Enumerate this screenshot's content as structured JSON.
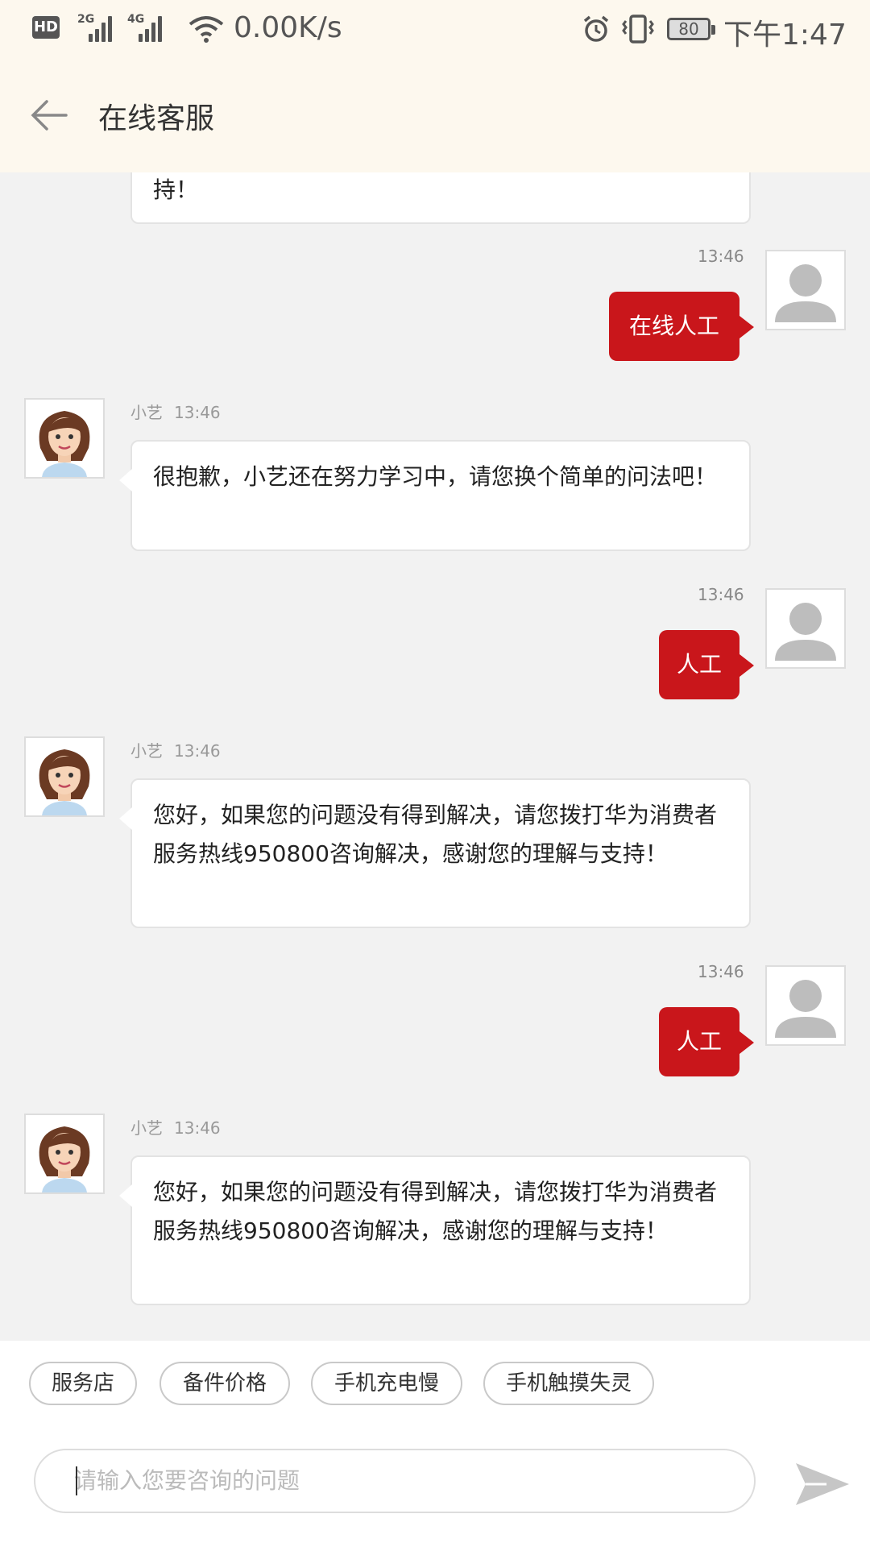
{
  "status_bar": {
    "hd": "HD",
    "sim1": "2G",
    "sim2": "4G",
    "net_speed": "0.00K/s",
    "battery": "80",
    "time": "下午1:47"
  },
  "header": {
    "title": "在线客服"
  },
  "colors": {
    "accent": "#c9161b",
    "header_bg": "#fdf8ee",
    "chat_bg": "#f2f2f2"
  },
  "messages": [
    {
      "from": "bot",
      "text_tail": "持！"
    },
    {
      "from": "user",
      "time": "13:46",
      "text": "在线人工"
    },
    {
      "from": "bot",
      "name": "小艺",
      "time": "13:46",
      "text": "很抱歉，小艺还在努力学习中，请您换个简单的问法吧！"
    },
    {
      "from": "user",
      "time": "13:46",
      "text": "人工"
    },
    {
      "from": "bot",
      "name": "小艺",
      "time": "13:46",
      "text": "您好，如果您的问题没有得到解决，请您拨打华为消费者服务热线950800咨询解决，感谢您的理解与支持！"
    },
    {
      "from": "user",
      "time": "13:46",
      "text": "人工"
    },
    {
      "from": "bot",
      "name": "小艺",
      "time": "13:46",
      "text": "您好，如果您的问题没有得到解决，请您拨打华为消费者服务热线950800咨询解决，感谢您的理解与支持！"
    }
  ],
  "quick_replies": [
    "服务店",
    "备件价格",
    "手机充电慢",
    "手机触摸失灵"
  ],
  "input": {
    "placeholder": "请输入您要咨询的问题"
  },
  "icons": {
    "back": "arrow-left-icon",
    "send": "send-icon",
    "user_avatar": "default-user-avatar",
    "bot_avatar": "xiaoyi-avatar"
  }
}
